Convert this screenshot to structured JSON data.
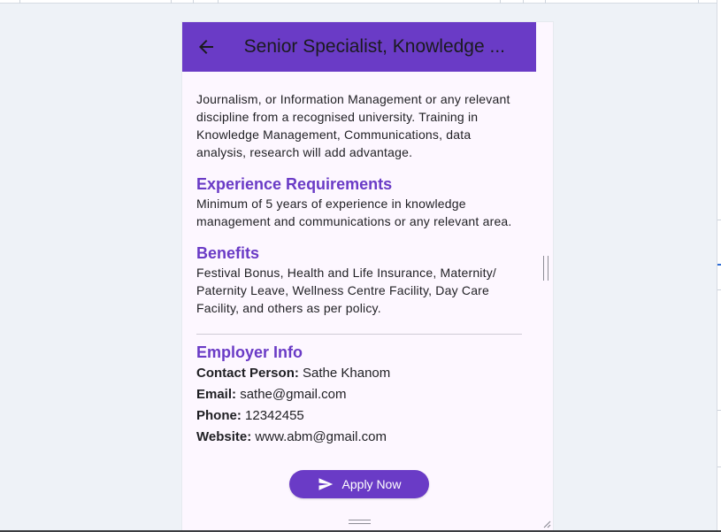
{
  "app": {
    "title": "Senior Specialist, Knowledge ..."
  },
  "content": {
    "education_partial": "Journalism, or Information Management or any relevant discipline from a recognised university. Training in Knowledge Management, Communications, data analysis, research will add advantage.",
    "experience": {
      "title": "Experience Requirements",
      "text": "Minimum of 5 years of experience in knowledge management and communications or any relevant area."
    },
    "benefits": {
      "title": "Benefits",
      "text": "Festival Bonus, Health and Life Insurance, Maternity/ Paternity Leave, Wellness Centre Facility, Day Care Facility, and others as per policy."
    },
    "employer": {
      "title": "Employer Info",
      "contact_label": "Contact Person:",
      "contact_value": "Sathe Khanom",
      "email_label": "Email:",
      "email_value": "sathe@gmail.com",
      "phone_label": "Phone:",
      "phone_value": "12342455",
      "website_label": "Website:",
      "website_value": "www.abm@gmail.com"
    }
  },
  "actions": {
    "apply_label": "Apply Now"
  },
  "icons": {
    "back": "arrow-left-icon",
    "send": "send-icon"
  },
  "colors": {
    "primary": "#6a3bc6",
    "background": "#fdf7ff"
  }
}
